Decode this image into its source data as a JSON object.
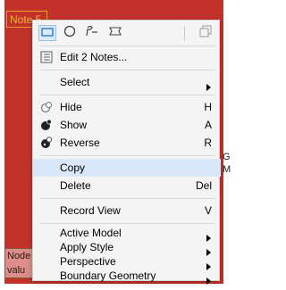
{
  "background": {
    "note_label": "Note 5",
    "side_text_right_1": "G",
    "side_text_right_2": "M",
    "bottom_note_line1": "Node",
    "bottom_note_line2": "valu"
  },
  "colors": {
    "red": "#c3322a",
    "accent_blue": "#1e73c9",
    "menu_bg": "#f4f4f4",
    "hover": "#d9e8f8"
  },
  "menu": {
    "shape_icons": [
      "rectangle-icon",
      "circle-icon",
      "callout-icon",
      "banner-icon"
    ],
    "copy_icon_right": "copy-disabled-icon",
    "edit_label": "Edit 2 Notes...",
    "select_label": "Select",
    "hide_label": "Hide",
    "hide_shortcut": "H",
    "show_label": "Show",
    "show_shortcut": "A",
    "reverse_label": "Reverse",
    "reverse_shortcut": "R",
    "copy_label": "Copy",
    "delete_label": "Delete",
    "delete_shortcut": "Del",
    "record_view_label": "Record View",
    "record_view_shortcut": "V",
    "active_model_label": "Active Model",
    "apply_style_label": "Apply Style",
    "perspective_label": "Perspective",
    "boundary_geometry_label": "Boundary Geometry"
  }
}
